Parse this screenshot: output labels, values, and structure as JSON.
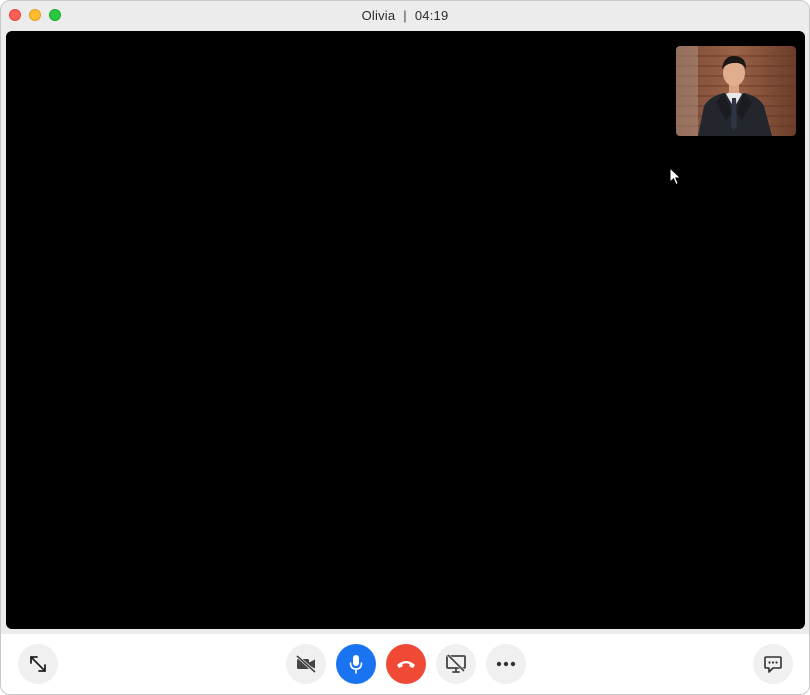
{
  "window": {
    "caller_name": "Olivia",
    "separator": "|",
    "call_duration": "04:19"
  },
  "self_view": {
    "description_icon": "person-in-suit-icon"
  },
  "controls": {
    "icons": {
      "fullscreen": "expand-arrows-icon",
      "camera": "video-off-icon",
      "microphone": "microphone-icon",
      "end_call": "phone-hangup-icon",
      "screen_share": "screen-share-off-icon",
      "more": "more-dots-icon",
      "chat": "chat-bubble-icon"
    },
    "colors": {
      "microphone_active": "#1a73f0",
      "end_call": "#f04a36",
      "button_default": "#f0f0f0"
    }
  }
}
